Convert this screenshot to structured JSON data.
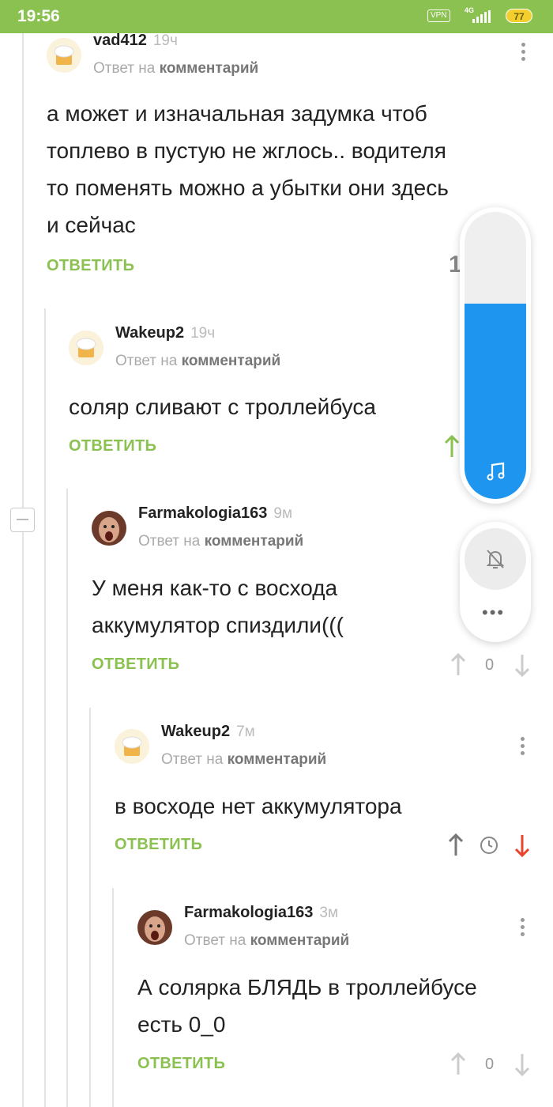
{
  "status_bar": {
    "time": "19:56",
    "vpn": "VPN",
    "network": "4G",
    "battery": "77"
  },
  "comments": [
    {
      "username": "vad412",
      "time": "19ч",
      "reply_prefix": "Ответ на",
      "reply_link": "комментарий",
      "lines": [
        "а может и изначальная задумка чтоб",
        "топлево в пустую не жглось.. водителя",
        "то поменять можно а убытки они здесь",
        "и сейчас"
      ],
      "reply_label": "ОТВЕТИТЬ",
      "rating_partial": "1"
    },
    {
      "username": "Wakeup2",
      "time": "19ч",
      "reply_prefix": "Ответ на",
      "reply_link": "комментарий",
      "lines": [
        "соляр сливают с троллейбуса"
      ],
      "reply_label": "ОТВЕТИТЬ"
    },
    {
      "username": "Farmakologia163",
      "time": "9м",
      "reply_prefix": "Ответ на",
      "reply_link": "комментарий",
      "lines": [
        "У меня как-то с восхода",
        "аккумулятор спиздили((("
      ],
      "reply_label": "ОТВЕТИТЬ",
      "rating": "0"
    },
    {
      "username": "Wakeup2",
      "time": "7м",
      "reply_prefix": "Ответ на",
      "reply_link": "комментарий",
      "lines": [
        "в восходе нет аккумулятора"
      ],
      "reply_label": "ОТВЕТИТЬ"
    },
    {
      "username": "Farmakologia163",
      "time": "3м",
      "reply_prefix": "Ответ на",
      "reply_link": "комментарий",
      "lines": [
        "А солярка БЛЯДЬ в троллейбусе",
        "есть 0_0"
      ],
      "reply_label": "ОТВЕТИТЬ",
      "rating": "0"
    }
  ],
  "volume_overlay": {
    "level_fraction": 0.68,
    "accent": "#1e96f0",
    "more_label": "•••"
  },
  "colors": {
    "brand_green": "#8ac150",
    "downvote_red": "#e8432c"
  },
  "icons": [
    "music-note-icon",
    "bell-off-icon",
    "arrow-up-icon",
    "arrow-down-icon",
    "clock-icon",
    "more-vert-icon"
  ]
}
